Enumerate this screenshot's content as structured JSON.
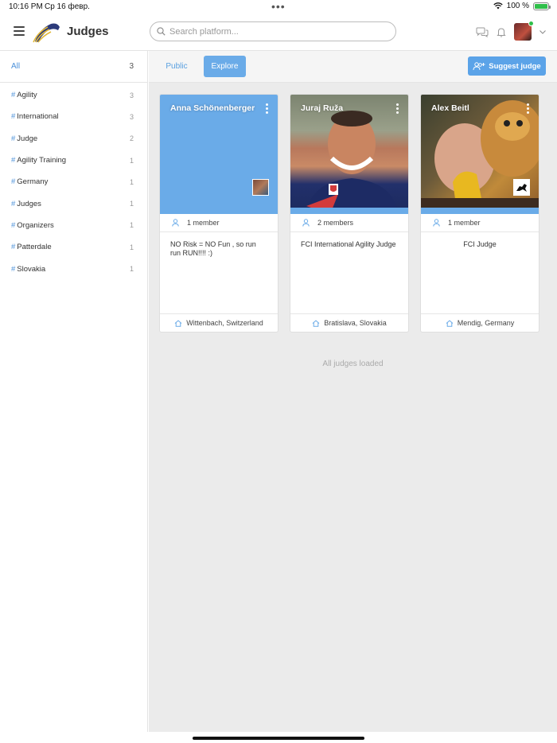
{
  "status_bar": {
    "time": "10:16 PM",
    "date": "Ср 16 февр.",
    "battery": "100 %",
    "battery_level": 1.0
  },
  "header": {
    "title": "Judges",
    "search_placeholder": "Search platform..."
  },
  "sidebar": {
    "all": {
      "label": "All",
      "count": "3"
    },
    "items": [
      {
        "label": "Agility",
        "count": "3"
      },
      {
        "label": "International",
        "count": "3"
      },
      {
        "label": "Judge",
        "count": "2"
      },
      {
        "label": "Agility Training",
        "count": "1"
      },
      {
        "label": "Germany",
        "count": "1"
      },
      {
        "label": "Judges",
        "count": "1"
      },
      {
        "label": "Organizers",
        "count": "1"
      },
      {
        "label": "Patterdale",
        "count": "1"
      },
      {
        "label": "Slovakia",
        "count": "1"
      }
    ]
  },
  "toolbar": {
    "tab_public": "Public",
    "tab_explore": "Explore",
    "suggest_button": "Suggest judge"
  },
  "cards": [
    {
      "name": "Anna Schönenberger",
      "members": "1 member",
      "description": "NO Risk = NO Fun , so run run RUN!!!! :)",
      "location": "Wittenbach, Switzerland"
    },
    {
      "name": "Juraj Ruža",
      "members": "2 members",
      "description": "FCI International Agility Judge",
      "location": "Bratislava, Slovakia"
    },
    {
      "name": "Alex Beitl",
      "members": "1 member",
      "description": "FCI Judge",
      "location": "Mendig, Germany"
    }
  ],
  "footer": {
    "loaded_text": "All judges loaded"
  },
  "colors": {
    "accent": "#4a90d9",
    "card_blue": "#6aabe8",
    "button_blue": "#5ba3e8",
    "online_green": "#2fbf4a"
  }
}
